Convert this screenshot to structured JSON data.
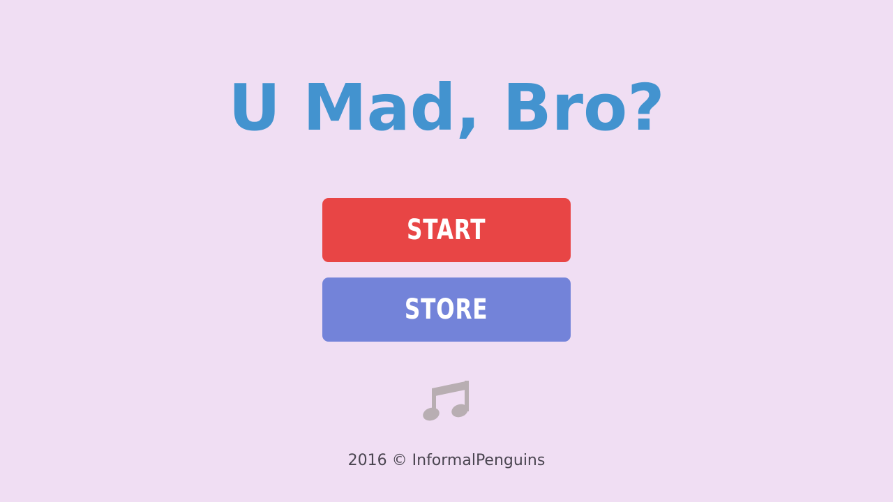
{
  "game": {
    "title": "U Mad, Bro?",
    "start_label": "START",
    "store_label": "STORE",
    "footer": "2016 © InformalPenguins"
  },
  "icons": {
    "music": "music-note-icon"
  },
  "colors": {
    "background": "#f0def3",
    "title": "#4393cf",
    "start_button": "#e84545",
    "store_button": "#7383d9",
    "music_icon": "#b8aeb2",
    "footer_text": "#4a4550"
  }
}
